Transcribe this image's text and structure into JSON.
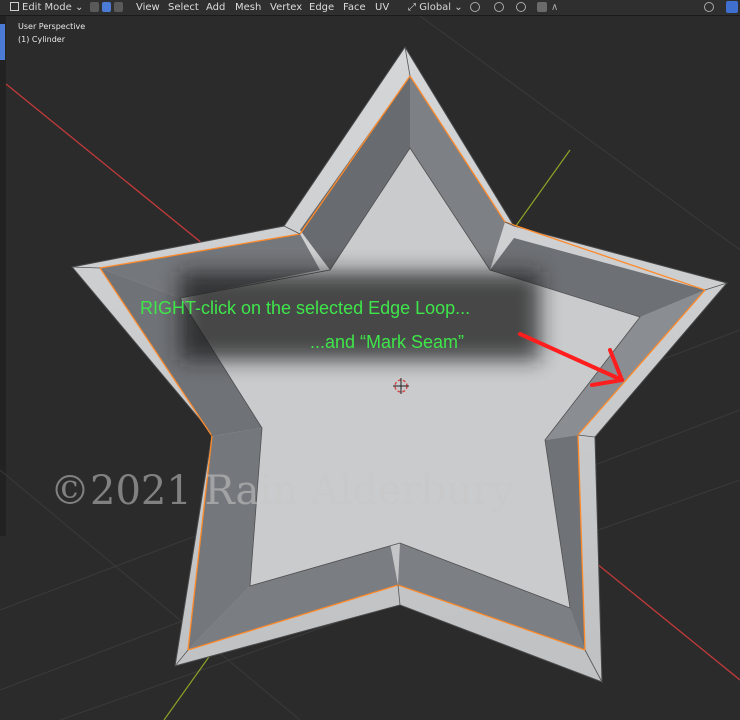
{
  "header": {
    "mode_label": "Edit Mode",
    "menus": [
      "View",
      "Select",
      "Add",
      "Mesh",
      "Vertex",
      "Edge",
      "Face",
      "UV"
    ],
    "transform_orientation": "Global"
  },
  "viewport": {
    "view_name": "User Perspective",
    "object_name": "(1) Cylinder"
  },
  "annotation": {
    "line1": "RIGHT-click on the selected Edge Loop...",
    "line2": "...and “Mark Seam”",
    "text_color": "#3ee64a",
    "arrow_color": "#ff1e1e"
  },
  "watermark": "©2021 Rain Alderbury",
  "colors": {
    "axis_x": "#c23a3a",
    "axis_y": "#8ba326",
    "selection": "#ff8a2a",
    "mesh_face": "#c9cbcd",
    "mesh_wall": "#777a7e",
    "background": "#2b2b2b"
  }
}
